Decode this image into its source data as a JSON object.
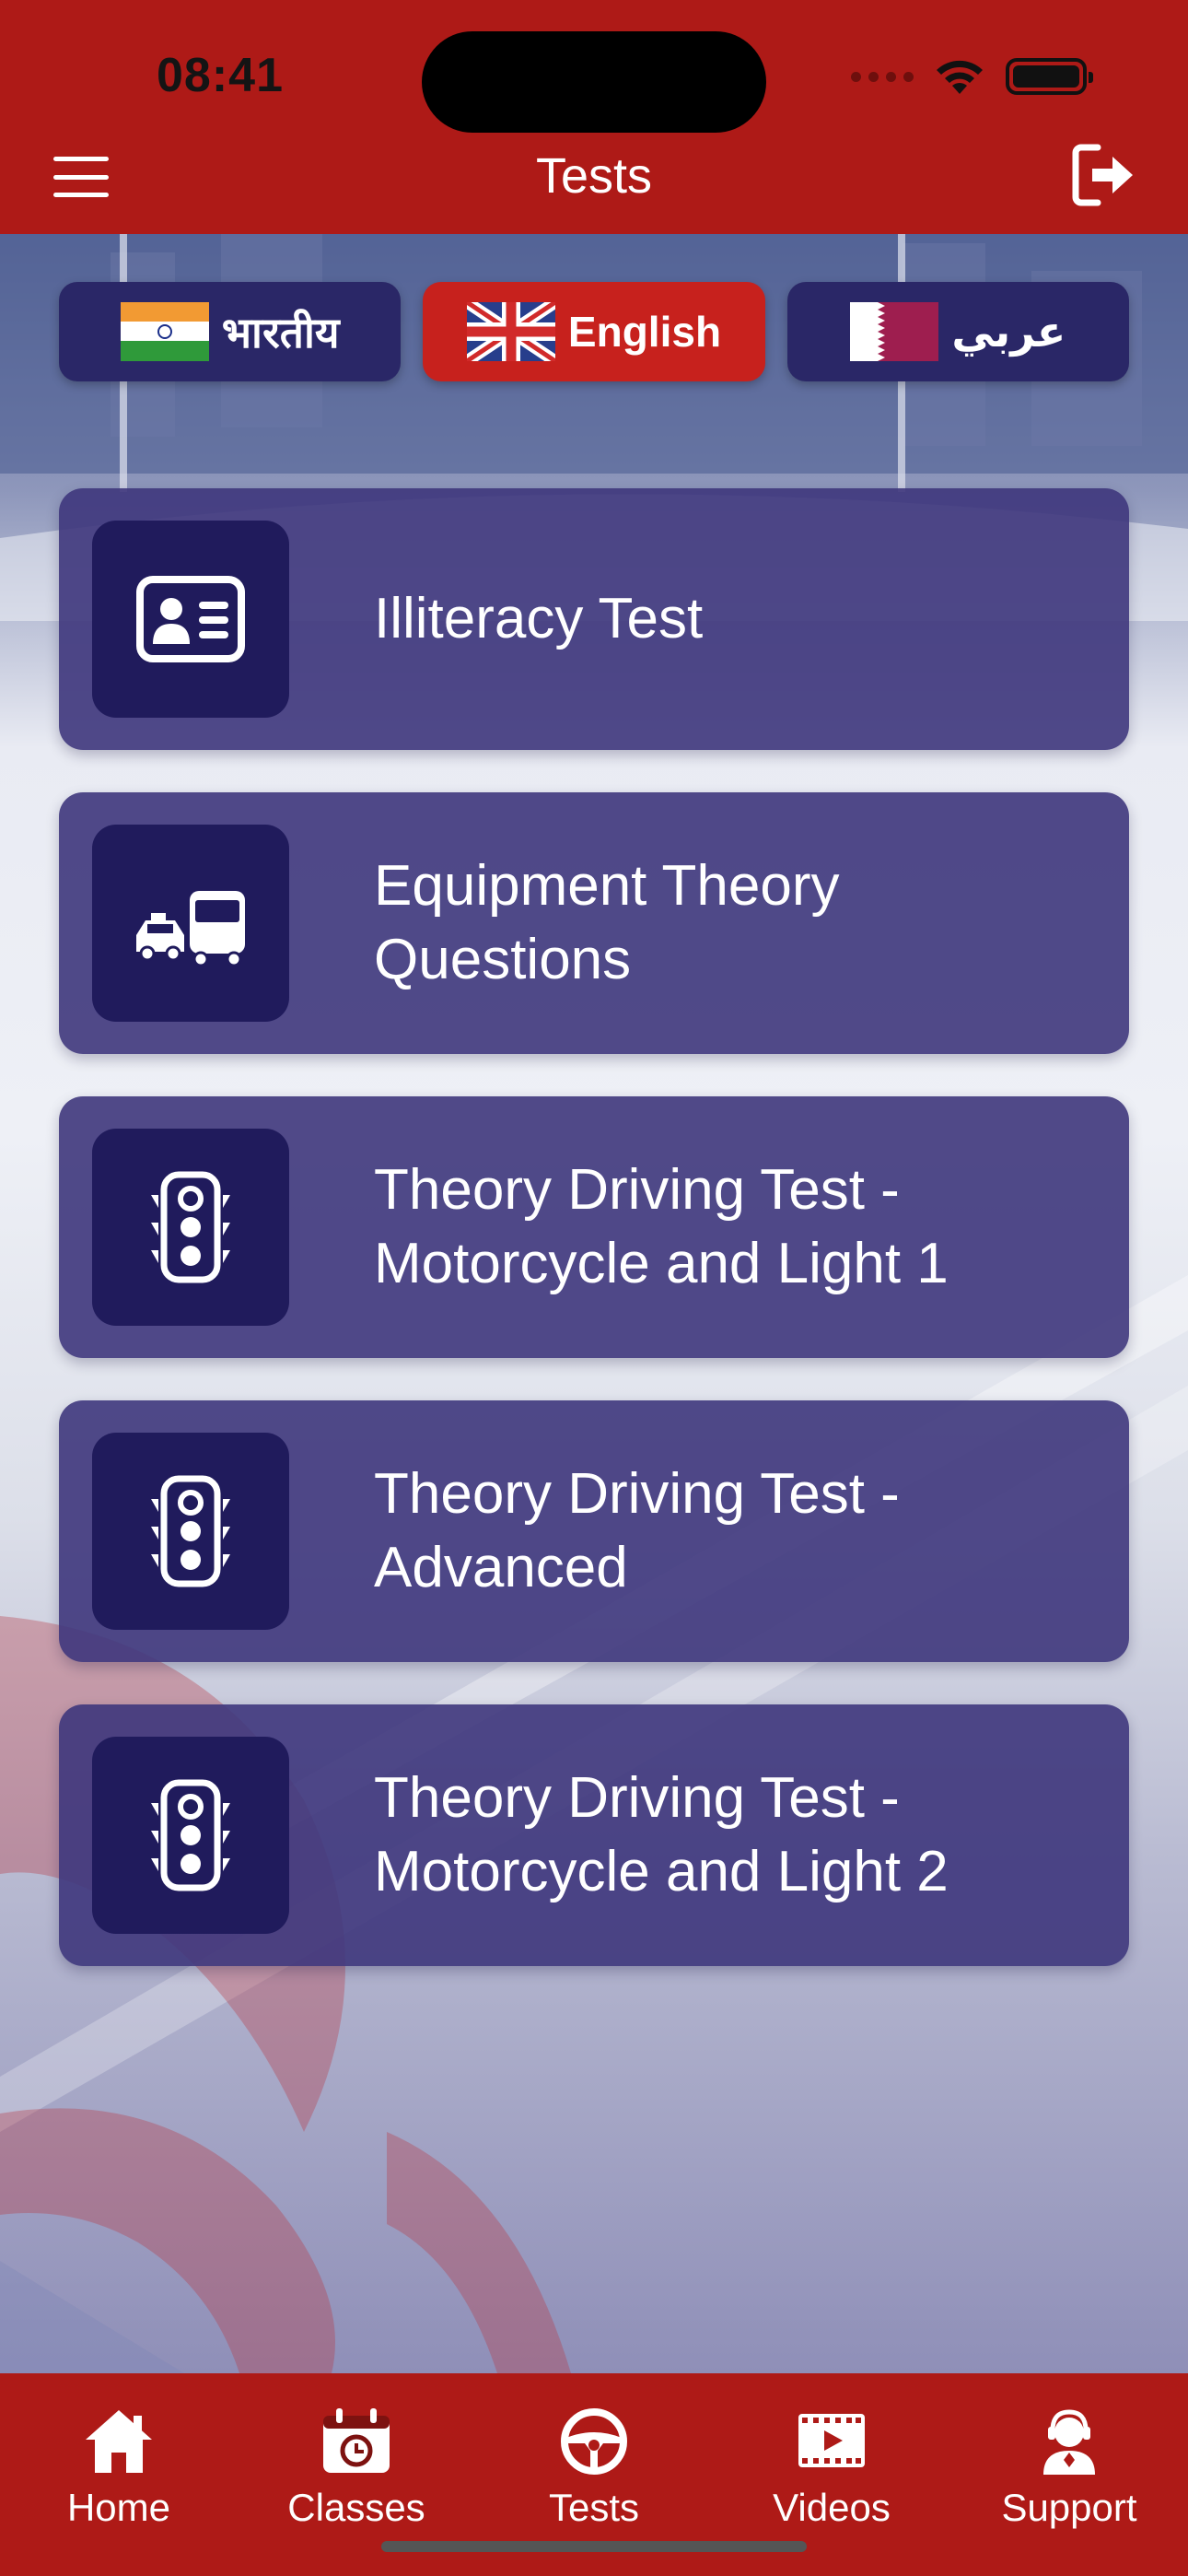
{
  "status_bar": {
    "time": "08:41"
  },
  "header": {
    "title": "Tests"
  },
  "languages": [
    {
      "label": "भारतीय",
      "flag": "india-flag",
      "active": false
    },
    {
      "label": "English",
      "flag": "uk-flag",
      "active": true
    },
    {
      "label": "عربي",
      "flag": "qatar-flag",
      "active": false
    }
  ],
  "tests": [
    {
      "label": "Illiteracy Test",
      "icon": "id-card-icon"
    },
    {
      "label": "Equipment Theory Questions",
      "icon": "vehicles-icon"
    },
    {
      "label": "Theory Driving Test - Motorcycle and Light 1",
      "icon": "traffic-light-icon"
    },
    {
      "label": "Theory Driving Test - Advanced",
      "icon": "traffic-light-icon"
    },
    {
      "label": "Theory Driving Test - Motorcycle and Light 2",
      "icon": "traffic-light-icon"
    }
  ],
  "bottom_nav": [
    {
      "label": "Home",
      "icon": "home-icon"
    },
    {
      "label": "Classes",
      "icon": "calendar-icon"
    },
    {
      "label": "Tests",
      "icon": "steering-wheel-icon"
    },
    {
      "label": "Videos",
      "icon": "video-icon"
    },
    {
      "label": "Support",
      "icon": "support-agent-icon"
    }
  ],
  "colors": {
    "brand_red": "#ae1a17",
    "card_purple": "#3e367c",
    "icon_tile": "#201b5c",
    "active_lang": "#c7211d"
  }
}
